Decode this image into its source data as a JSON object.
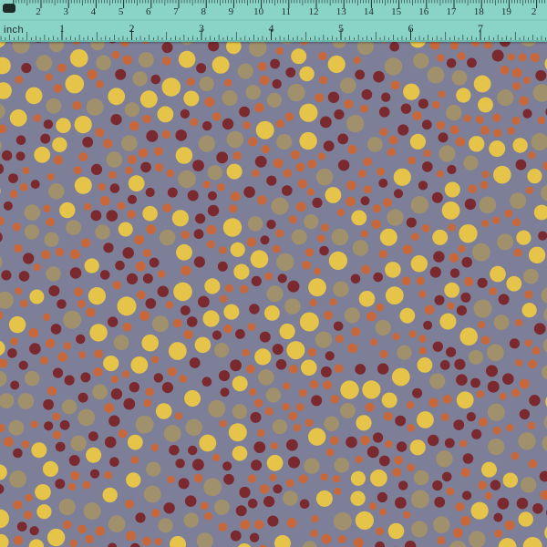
{
  "ruler": {
    "inch_unit_label": "inch",
    "cm_marks": [
      "2",
      "3",
      "4",
      "5",
      "6",
      "7",
      "8",
      "9",
      "10",
      "11",
      "12",
      "13",
      "14",
      "15",
      "16",
      "17",
      "18",
      "19",
      "2"
    ],
    "inch_marks": [
      "1",
      "2",
      "3",
      "4",
      "5",
      "6",
      "7"
    ]
  },
  "fabric": {
    "background_color": "#7d7f98",
    "dot_colors": {
      "yellow": "#e6c44a",
      "taupe": "#a0906c",
      "rust": "#c8683a",
      "maroon": "#7a2a2e"
    },
    "pattern": "polka-dot"
  }
}
